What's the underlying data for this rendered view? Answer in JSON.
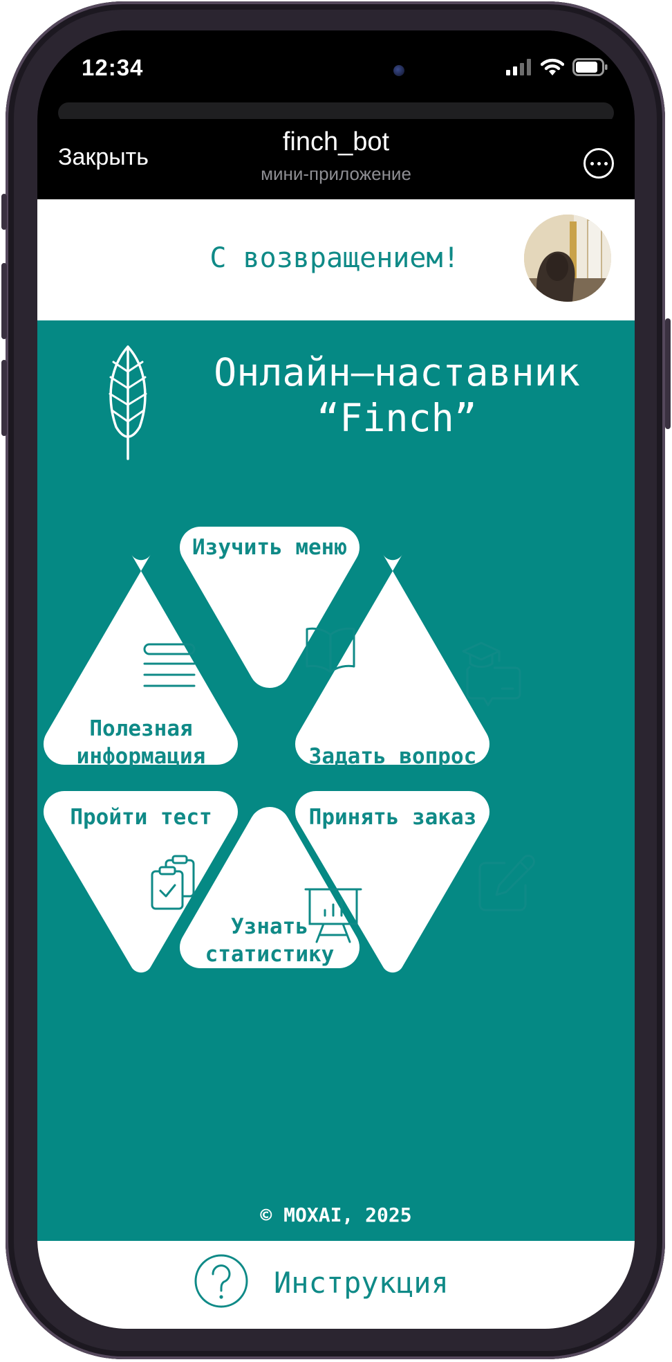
{
  "status_bar": {
    "time": "12:34"
  },
  "top_bar": {
    "close_label": "Закрыть",
    "bot_name": "finch_bot",
    "bot_subtitle": "мини-приложение"
  },
  "welcome": {
    "greeting": "С возвращением!"
  },
  "header": {
    "line1": "Онлайн–наставник",
    "line2": "“Finch”"
  },
  "tiles": {
    "menu": {
      "label": "Изучить меню",
      "icon": "open-book-icon"
    },
    "info": {
      "label_line1": "Полезная",
      "label_line2": "информация",
      "icon": "list-lines-icon"
    },
    "ask": {
      "label": "Задать вопрос",
      "icon": "graduation-chat-icon"
    },
    "test": {
      "label": "Пройти тест",
      "icon": "clipboard-check-icon"
    },
    "order": {
      "label": "Принять заказ",
      "icon": "edit-pencil-icon"
    },
    "stats": {
      "label_line1": "Узнать",
      "label_line2": "статистику",
      "icon": "presentation-chart-icon"
    }
  },
  "footer": {
    "copyright": "© MOXAI, 2025"
  },
  "bottom_bar": {
    "label": "Инструкция",
    "icon": "question-circle-icon"
  },
  "colors": {
    "teal": "#058984",
    "teal_text": "#0f8a87",
    "white": "#ffffff",
    "black": "#000000"
  }
}
